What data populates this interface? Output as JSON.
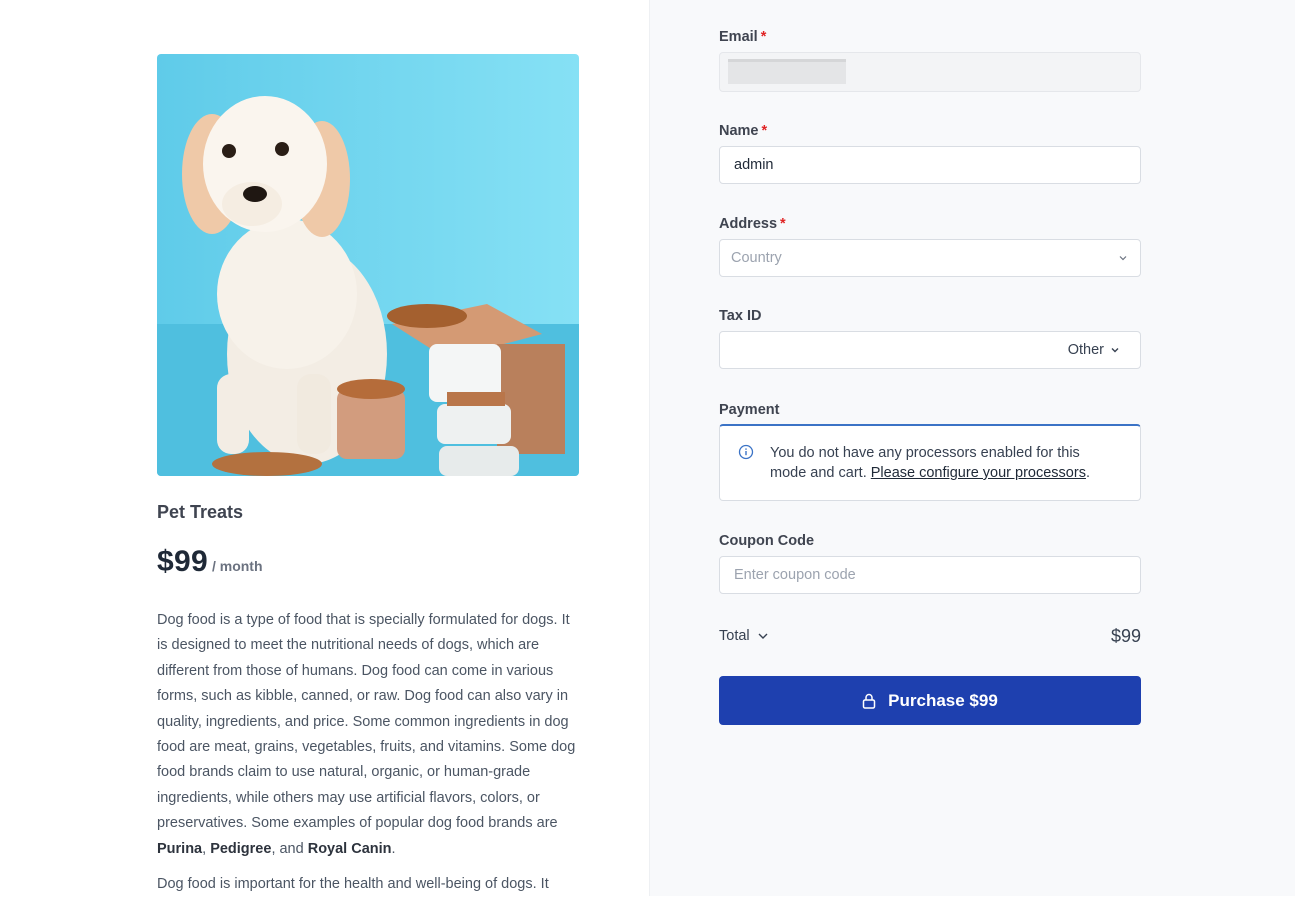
{
  "product": {
    "name": "Pet Treats",
    "price": "$99",
    "interval": "/ month",
    "description": {
      "p1_text": "Dog food is a type of food that is specially formulated for dogs. It is designed to meet the nutritional needs of dogs, which are different from those of humans. Dog food can come in various forms, such as kibble, canned, or raw. Dog food can also vary in quality, ingredients, and price. Some common ingredients in dog food are meat, grains, vegetables, fruits, and vitamins. Some dog food brands claim to use natural, organic, or human-grade ingredients, while others may use artificial flavors, colors, or preservatives. Some examples of popular dog food brands are ",
      "brand1": "Purina",
      "sep1": ", ",
      "brand2": "Pedigree",
      "sep2": ", and ",
      "brand3": "Royal Canin",
      "end": ".",
      "p2_text": "Dog food is important for the health and well-being of dogs. It"
    }
  },
  "form": {
    "email": {
      "label": "Email",
      "required_mark": "*",
      "value": ""
    },
    "name": {
      "label": "Name",
      "required_mark": "*",
      "value": "admin"
    },
    "address": {
      "label": "Address",
      "required_mark": "*",
      "placeholder": "Country"
    },
    "tax_id": {
      "label": "Tax ID",
      "value": "",
      "type": "Other"
    },
    "payment": {
      "label": "Payment",
      "notice_text": "You do not have any processors enabled for this mode and cart. ",
      "notice_link": "Please configure your processors",
      "notice_end": "."
    },
    "coupon": {
      "label": "Coupon Code",
      "placeholder": "Enter coupon code"
    },
    "total": {
      "label": "Total",
      "amount": "$99"
    },
    "purchase_button": "Purchase $99"
  },
  "icons": {
    "chevron": "chevron-down-icon",
    "info": "info-icon",
    "lock": "lock-icon"
  },
  "colors": {
    "accent": "#1e40af",
    "required": "#e02424",
    "notice_border": "#3b73c6"
  }
}
